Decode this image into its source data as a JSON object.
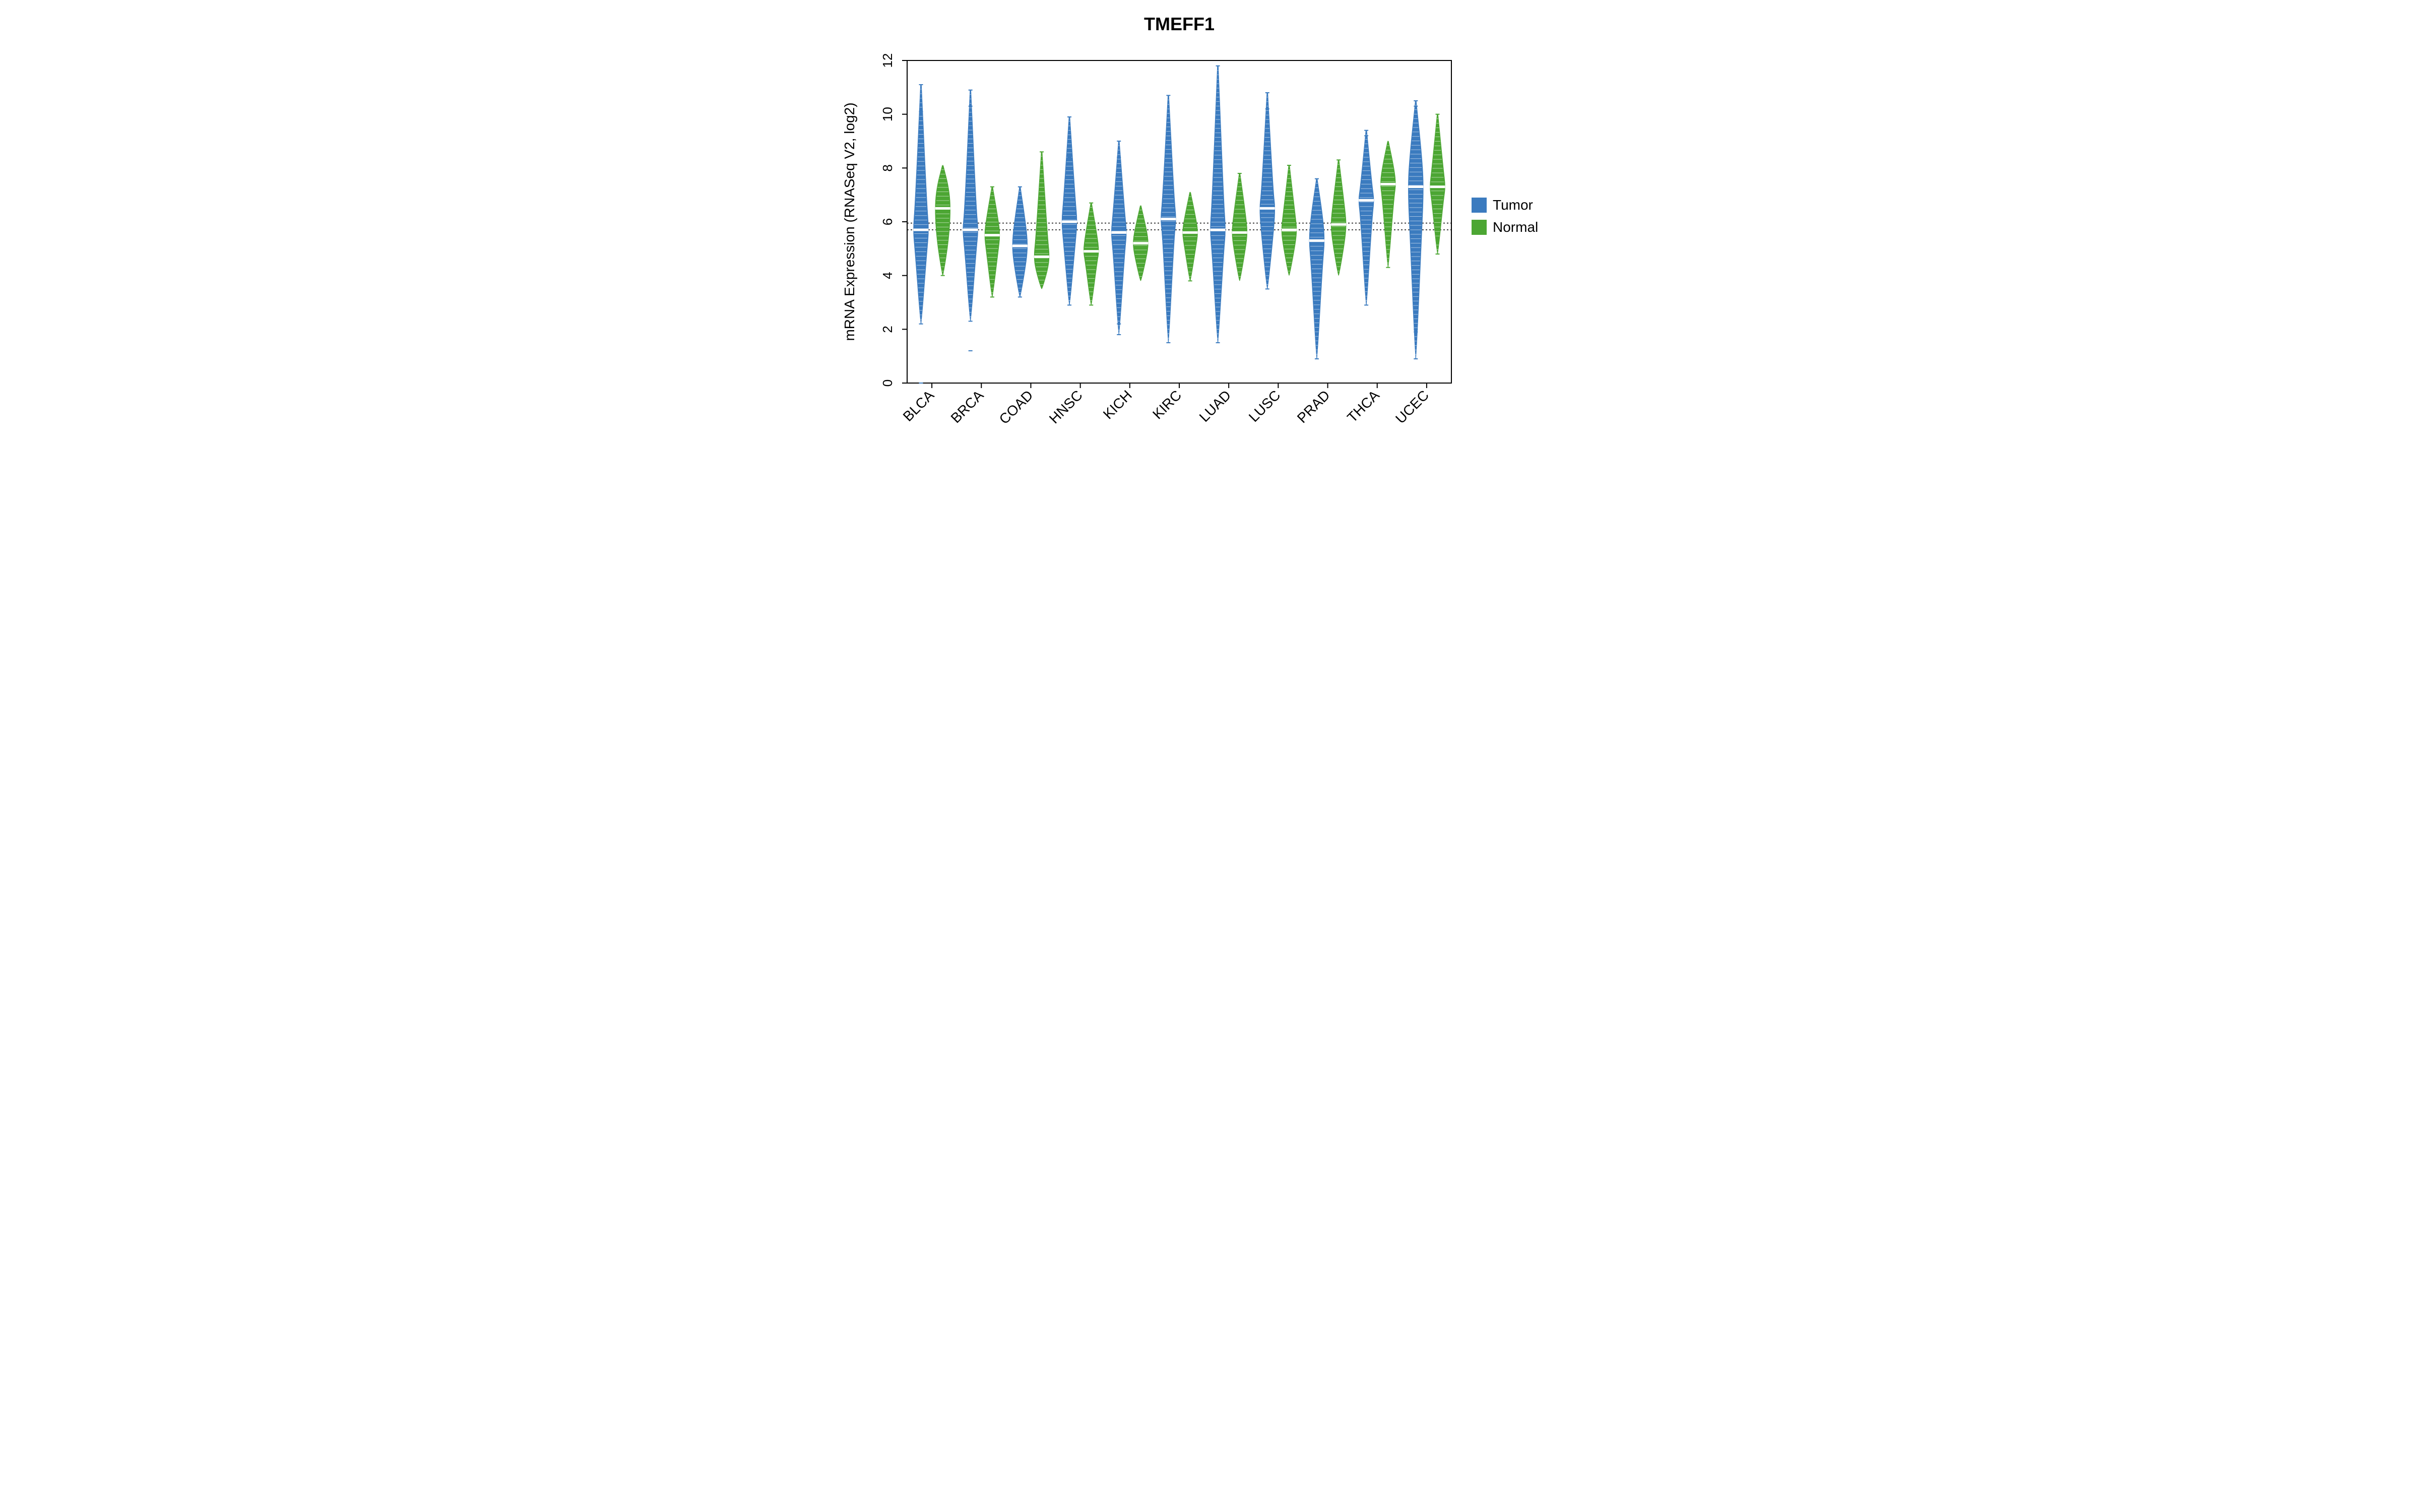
{
  "chart_data": {
    "type": "violin",
    "title": "TMEFF1",
    "xlabel": "",
    "ylabel": "mRNA Expression (RNASeq V2, log2)",
    "ylim": [
      0,
      12
    ],
    "yticks": [
      0,
      2,
      4,
      6,
      8,
      10,
      12
    ],
    "hlines": [
      5.7,
      5.95
    ],
    "categories": [
      "BLCA",
      "BRCA",
      "COAD",
      "HNSC",
      "KICH",
      "KIRC",
      "LUAD",
      "LUSC",
      "PRAD",
      "THCA",
      "UCEC"
    ],
    "series": [
      {
        "name": "Tumor",
        "color": "#3b7bbf",
        "violins": [
          {
            "median": 5.7,
            "q1": 4.9,
            "q3": 6.6,
            "lower": 2.2,
            "upper": 11.1,
            "outliers": [
              0.0,
              2.2,
              9.5,
              10.1,
              11.1
            ]
          },
          {
            "median": 5.7,
            "q1": 5.0,
            "q3": 6.4,
            "lower": 2.3,
            "upper": 10.9,
            "outliers": [
              1.2,
              2.3,
              9.6,
              10.3,
              10.9
            ]
          },
          {
            "median": 5.1,
            "q1": 4.4,
            "q3": 5.9,
            "lower": 3.2,
            "upper": 7.3,
            "outliers": [
              3.2,
              7.3
            ]
          },
          {
            "median": 6.0,
            "q1": 5.2,
            "q3": 6.8,
            "lower": 2.9,
            "upper": 9.9,
            "outliers": [
              2.9,
              8.4,
              8.7,
              9.9
            ]
          },
          {
            "median": 5.6,
            "q1": 4.9,
            "q3": 6.3,
            "lower": 1.8,
            "upper": 9.0,
            "outliers": [
              1.8,
              2.2,
              8.4,
              9.0
            ]
          },
          {
            "median": 6.1,
            "q1": 5.5,
            "q3": 6.8,
            "lower": 1.5,
            "upper": 10.7,
            "outliers": [
              1.5,
              3.8,
              10.7
            ]
          },
          {
            "median": 5.7,
            "q1": 4.9,
            "q3": 6.7,
            "lower": 1.5,
            "upper": 11.8,
            "outliers": [
              1.5,
              10.2,
              11.8
            ]
          },
          {
            "median": 6.5,
            "q1": 5.5,
            "q3": 7.1,
            "lower": 3.5,
            "upper": 10.8,
            "outliers": [
              3.5,
              10.2,
              10.8
            ]
          },
          {
            "median": 5.3,
            "q1": 4.5,
            "q3": 6.2,
            "lower": 0.9,
            "upper": 7.6,
            "outliers": [
              0.9,
              2.0,
              7.6
            ]
          },
          {
            "median": 6.8,
            "q1": 6.2,
            "q3": 7.3,
            "lower": 2.9,
            "upper": 9.4,
            "outliers": [
              2.9,
              4.1,
              9.2,
              9.4
            ]
          },
          {
            "median": 7.3,
            "q1": 5.5,
            "q3": 8.5,
            "lower": 0.9,
            "upper": 10.5,
            "outliers": [
              0.9,
              1.9,
              2.0,
              10.3,
              10.5
            ]
          }
        ]
      },
      {
        "name": "Normal",
        "color": "#4ca633",
        "violins": [
          {
            "median": 6.5,
            "q1": 5.3,
            "q3": 7.3,
            "lower": 4.0,
            "upper": 8.1,
            "outliers": [
              4.0
            ]
          },
          {
            "median": 5.5,
            "q1": 4.9,
            "q3": 6.1,
            "lower": 3.2,
            "upper": 7.3,
            "outliers": [
              3.2,
              7.3
            ]
          },
          {
            "median": 4.7,
            "q1": 4.2,
            "q3": 5.4,
            "lower": 3.5,
            "upper": 8.6,
            "outliers": [
              7.5,
              8.6
            ]
          },
          {
            "median": 4.9,
            "q1": 4.5,
            "q3": 5.5,
            "lower": 2.9,
            "upper": 6.7,
            "outliers": [
              2.9,
              6.7
            ]
          },
          {
            "median": 5.2,
            "q1": 4.7,
            "q3": 5.7,
            "lower": 3.8,
            "upper": 6.6,
            "outliers": []
          },
          {
            "median": 5.6,
            "q1": 5.1,
            "q3": 6.1,
            "lower": 3.8,
            "upper": 7.1,
            "outliers": [
              3.8
            ]
          },
          {
            "median": 5.6,
            "q1": 5.0,
            "q3": 6.3,
            "lower": 3.8,
            "upper": 7.8,
            "outliers": [
              7.8
            ]
          },
          {
            "median": 5.7,
            "q1": 5.1,
            "q3": 6.3,
            "lower": 4.0,
            "upper": 8.1,
            "outliers": [
              8.1
            ]
          },
          {
            "median": 5.9,
            "q1": 5.2,
            "q3": 6.6,
            "lower": 4.0,
            "upper": 8.3,
            "outliers": [
              8.3
            ]
          },
          {
            "median": 7.4,
            "q1": 6.9,
            "q3": 8.0,
            "lower": 4.3,
            "upper": 9.0,
            "outliers": [
              4.3
            ]
          },
          {
            "median": 7.3,
            "q1": 6.8,
            "q3": 7.9,
            "lower": 4.8,
            "upper": 10.0,
            "outliers": [
              4.8,
              5.3,
              10.0
            ]
          }
        ]
      }
    ],
    "legend": {
      "position": "right",
      "items": [
        {
          "label": "Tumor",
          "color": "#3b7bbf"
        },
        {
          "label": "Normal",
          "color": "#4ca633"
        }
      ]
    }
  }
}
